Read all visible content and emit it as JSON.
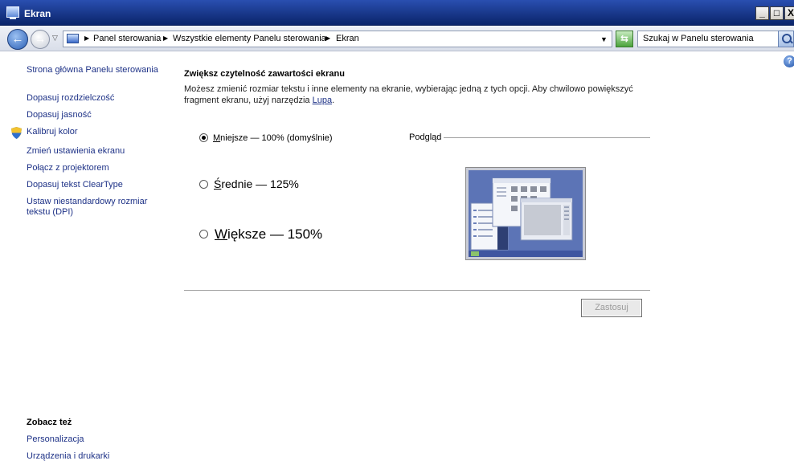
{
  "window": {
    "title": "Ekran",
    "minimize": "_",
    "maximize": "□",
    "close": "X"
  },
  "address_bar": {
    "breadcrumbs": [
      "Panel sterowania",
      "Wszystkie elementy Panelu sterowania",
      "Ekran"
    ],
    "search_placeholder": "Szukaj w Panelu sterowania"
  },
  "sidebar": {
    "links": [
      "Strona główna Panelu sterowania",
      "Dopasuj rozdzielczość",
      "Dopasuj jasność",
      "Kalibruj kolor",
      "Zmień ustawienia ekranu",
      "Połącz z projektorem",
      "Dopasuj tekst ClearType",
      "Ustaw niestandardowy rozmiar",
      "tekstu (DPI)"
    ],
    "see_also_title": "Zobacz też",
    "see_also": [
      "Personalizacja",
      "Urządzenia i drukarki"
    ]
  },
  "main": {
    "heading": "Zwiększ czytelność zawartości ekranu",
    "desc_line1": "Możesz zmienić rozmiar tekstu i inne elementy na ekranie, wybierając jedną z tych opcji. Aby chwilowo powiększyć",
    "desc_line2_pre": "fragment ekranu, użyj narzędzia ",
    "desc_link": "Lupa",
    "desc_line2_post": ".",
    "options": [
      {
        "first": "M",
        "rest": "niejsze — 100% (domyślnie)",
        "checked": true
      },
      {
        "first": "Ś",
        "rest": "rednie — 125%",
        "checked": false
      },
      {
        "first": "W",
        "rest": "iększe — 150%",
        "checked": false
      }
    ],
    "preview_label": "Podgląd",
    "apply_label": "Zastosuj"
  },
  "icons": {
    "back": "arrow-left-icon",
    "forward": "arrow-right-icon",
    "refresh": "refresh-icon",
    "search": "search-icon",
    "help": "help-icon",
    "shield": "shield-icon"
  },
  "colors": {
    "titlebar": "#0a246a",
    "link": "#1e3287",
    "preview_bg": "#5a74b8"
  }
}
